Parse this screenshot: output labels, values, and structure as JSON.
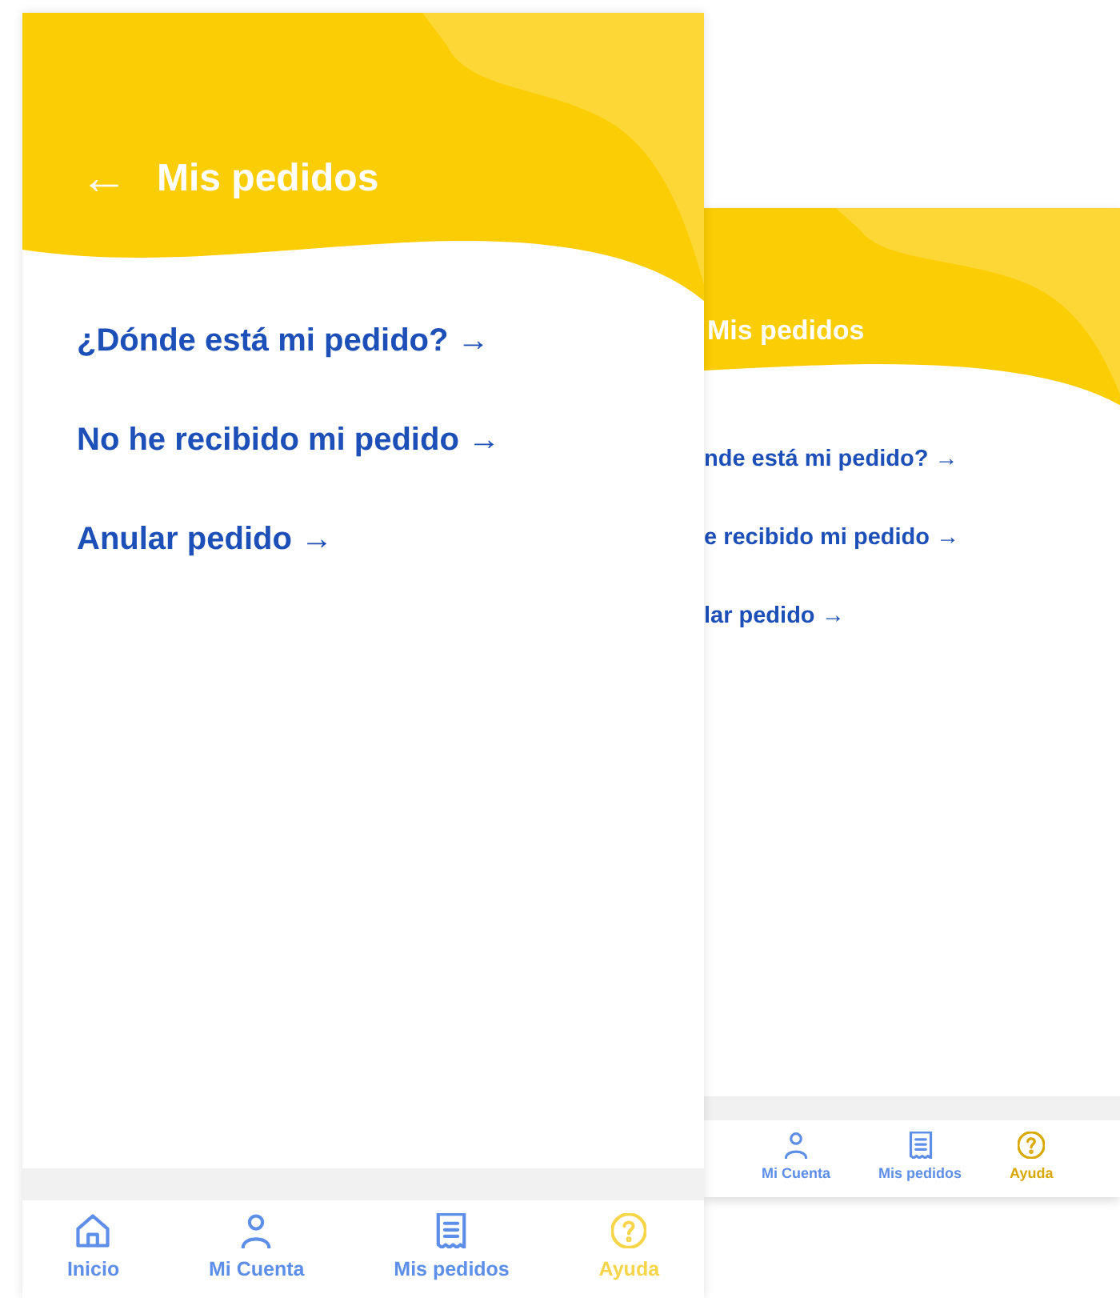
{
  "screens": [
    {
      "kind": "front",
      "title": "Mis pedidos",
      "back": "←",
      "links": [
        {
          "label": "¿Dónde está mi pedido?",
          "arrow": "→"
        },
        {
          "label": "No he recibido mi pedido",
          "arrow": "→"
        },
        {
          "label": "Anular pedido",
          "arrow": "→"
        }
      ],
      "nav": [
        {
          "label": "Inicio",
          "kind": "home",
          "selected": false
        },
        {
          "label": "Mi Cuenta",
          "kind": "user",
          "selected": false
        },
        {
          "label": "Mis pedidos",
          "kind": "receipt",
          "selected": false
        },
        {
          "label": "Ayuda",
          "kind": "help",
          "selected": true
        }
      ]
    },
    {
      "kind": "back",
      "title": "Mis pedidos",
      "links": [
        {
          "label": "nde está mi pedido?",
          "arrow": "→"
        },
        {
          "label": "e recibido mi pedido",
          "arrow": "→"
        },
        {
          "label": "lar pedido",
          "arrow": "→"
        }
      ],
      "nav": [
        {
          "label": "Mi Cuenta",
          "kind": "user",
          "selected": false
        },
        {
          "label": "Mis pedidos",
          "kind": "receipt",
          "selected": false
        },
        {
          "label": "Ayuda",
          "kind": "help",
          "selected": true
        }
      ]
    }
  ]
}
